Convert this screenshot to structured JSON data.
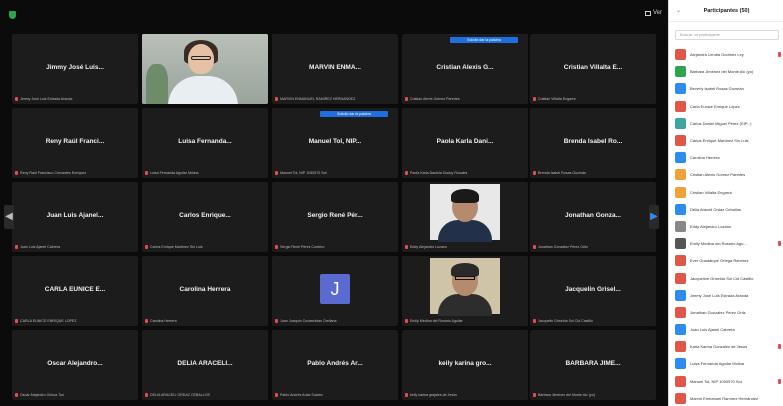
{
  "toolbar": {
    "view_label": "Ver"
  },
  "sidebar": {
    "title": "Participantes (50)",
    "search_placeholder": "Buscar un participante",
    "participants": [
      {
        "name": "Alejandra Urrutia Godínez Ley",
        "color": "#e0574a",
        "mic_muted": true
      },
      {
        "name": "Bárbara Jiménez del Monte Alc (yo)",
        "color": "#2da44e",
        "mic_muted": false
      },
      {
        "name": "Beverly Isabel Rosas Guzmán",
        "color": "#2d8cf0",
        "mic_muted": false
      },
      {
        "name": "Carla Eunice Enrique López",
        "color": "#e0574a",
        "mic_muted": false
      },
      {
        "name": "Carlos Daniel Miguel Pérez (SIP...)",
        "color": "#3fa4a0",
        "mic_muted": false
      },
      {
        "name": "Carlos Enrique Martínez Sin Luis",
        "color": "#e0574a",
        "mic_muted": false
      },
      {
        "name": "Carolina Herrera",
        "color": "#2d8cf0",
        "mic_muted": false
      },
      {
        "name": "Cristian Alexis Gómez Paredes",
        "color": "#f0a23a",
        "mic_muted": false
      },
      {
        "name": "Cristian Villalta Engarrá",
        "color": "#f0a23a",
        "mic_muted": false
      },
      {
        "name": "Delia Araceli Ordaz Ceballos",
        "color": "#2d8cf0",
        "mic_muted": false
      },
      {
        "name": "Eddy Alejandro Lozano",
        "color": "#888888",
        "mic_muted": false
      },
      {
        "name": "Emily Medina del Rosario Agu...",
        "color": "#555555",
        "mic_muted": true
      },
      {
        "name": "Ever Guadalupe Ortega Ramírez",
        "color": "#e0574a",
        "mic_muted": false
      },
      {
        "name": "Jacqueline Griselda Sol Cid Castillo",
        "color": "#e0574a",
        "mic_muted": false
      },
      {
        "name": "Jimmy José Luis Estrada Aranda",
        "color": "#2d8cf0",
        "mic_muted": false
      },
      {
        "name": "Jonathan Gonzalez Pérez Ortiz",
        "color": "#e0574a",
        "mic_muted": false
      },
      {
        "name": "Juan Luis Ajanel Cabrera",
        "color": "#2d8cf0",
        "mic_muted": false
      },
      {
        "name": "Karla Karina González de Jesús",
        "color": "#e0574a",
        "mic_muted": true
      },
      {
        "name": "Luisa Fernanda Aguilar Molina",
        "color": "#2d8cf0",
        "mic_muted": false
      },
      {
        "name": "Manuel Tol, NIP 1050570 Sot",
        "color": "#e0574a",
        "mic_muted": true
      },
      {
        "name": "Marvin Enmanuel Ramírez Hernández",
        "color": "#e0574a",
        "mic_muted": false
      }
    ]
  },
  "tiles": [
    {
      "name": "Jimmy José Luis...",
      "label": "Jimmy José Luis Estrada Aranda",
      "type": "name"
    },
    {
      "name": "",
      "label": "",
      "type": "video-woman"
    },
    {
      "name": "MARVIN ENMA...",
      "label": "MARVIN ENMANUEL RAMIREZ HERNANDEZ",
      "type": "name"
    },
    {
      "name": "Cristian Alexis G...",
      "label": "Cristian Alexis Gómez Paredes",
      "type": "name",
      "caption": "Solicitó dar la palabra"
    },
    {
      "name": "Cristian Villalta E...",
      "label": "Cristian Villalta Engarrá",
      "type": "name"
    },
    {
      "name": "Reny Raúl Franci...",
      "label": "Reny Raúl Francisco Cervantes Enríquez",
      "type": "name"
    },
    {
      "name": "Luisa Fernanda...",
      "label": "Luisa Fernanda Aguilar Molina",
      "type": "name"
    },
    {
      "name": "Manuel Tol, NIP...",
      "label": "Manuel Tol, NIP 1050570 Sot",
      "type": "name",
      "caption": "Solicitó dar la palabra"
    },
    {
      "name": "Paola Karla Dani...",
      "label": "Paola Karla Daniela Godoy Rosales",
      "type": "name"
    },
    {
      "name": "Brenda Isabel Ro...",
      "label": "Brenda Isabel Rosas Guzmán",
      "type": "name"
    },
    {
      "name": "Juan Luis Ajanel...",
      "label": "Juan Luis Ajanel Cabrera",
      "type": "name"
    },
    {
      "name": "Carlos Enrique...",
      "label": "Carlos Enrique Martínez Sin Luis",
      "type": "name"
    },
    {
      "name": "Sergio René Pér...",
      "label": "Sergio René Pérez Cordero",
      "type": "name"
    },
    {
      "name": "",
      "label": "Eddy Alejandro Lozano",
      "type": "photo-blue"
    },
    {
      "name": "Jonathan Gonza...",
      "label": "Jonathan Gonzalez Pérez Ortiz",
      "type": "name"
    },
    {
      "name": "CARLA EUNICE E...",
      "label": "CARLA EUNICE ENRIQUE LOPEZ",
      "type": "name"
    },
    {
      "name": "Carolina Herrera",
      "label": "Carolina Herrera",
      "type": "name"
    },
    {
      "name": "",
      "label": "Juan Joaquín Covarrubias Orellana",
      "type": "avatar",
      "initial": "J"
    },
    {
      "name": "",
      "label": "Emily Medina del Rosario Aguilar",
      "type": "photo-beige"
    },
    {
      "name": "Jacquelin Grisel...",
      "label": "Jacquelin Griselda Sol Cid Castillo",
      "type": "name"
    },
    {
      "name": "Oscar Alejandro...",
      "label": "Oscar Alejandro Ochoa Tun",
      "type": "name"
    },
    {
      "name": "DELIA ARACELI...",
      "label": "DELIA ARACELI ORDAZ CEBALLOS",
      "type": "name"
    },
    {
      "name": "Pablo Andrés Ar...",
      "label": "Pablo Andrés Arias Suárez",
      "type": "name"
    },
    {
      "name": "keily karina gro...",
      "label": "keily karina grajales de Jesús",
      "type": "name"
    },
    {
      "name": "BARBARA JIME...",
      "label": "Bárbara Jiménez del Monte Alc (yo)",
      "type": "name"
    }
  ]
}
